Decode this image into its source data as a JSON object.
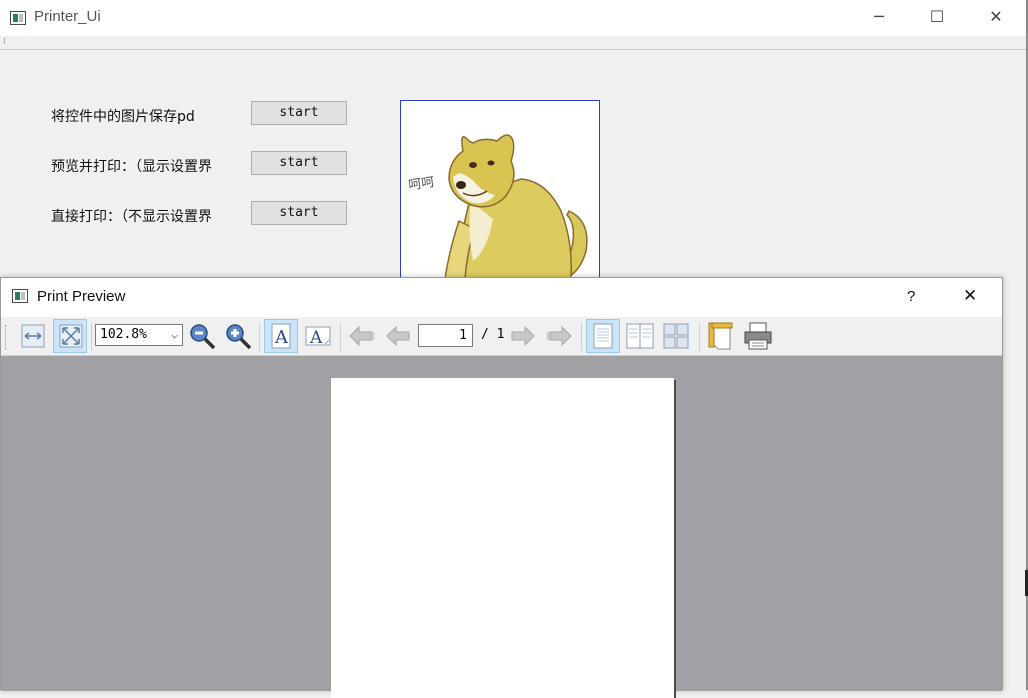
{
  "main_window": {
    "title": "Printer_Ui",
    "controls": {
      "minimize": "─",
      "maximize": "☐",
      "close": "✕"
    },
    "menu_grip": "⁞",
    "rows": [
      {
        "label": "将控件中的图片保存pd",
        "button": "start"
      },
      {
        "label": "预览并打印：（显示设置界",
        "button": "start"
      },
      {
        "label": "直接打印：（不显示设置界",
        "button": "start"
      }
    ],
    "image_caption": "呵呵"
  },
  "print_preview": {
    "title": "Print Preview",
    "help": "?",
    "close": "✕",
    "toolbar": {
      "zoom_value": "102.8%",
      "current_page": "1",
      "page_total": "/ 1",
      "icons": [
        "fit-width-icon",
        "fit-page-icon",
        "zoom-out-icon",
        "zoom-in-icon",
        "portrait-icon",
        "landscape-icon",
        "first-page-icon",
        "previous-page-icon",
        "next-page-icon",
        "last-page-icon",
        "single-page-icon",
        "facing-pages-icon",
        "overview-icon",
        "page-setup-icon",
        "print-icon"
      ]
    }
  },
  "colors": {
    "canvas": "#a0a0a5",
    "checked": "#cce4f7",
    "frame_border": "#2a3fc7"
  }
}
